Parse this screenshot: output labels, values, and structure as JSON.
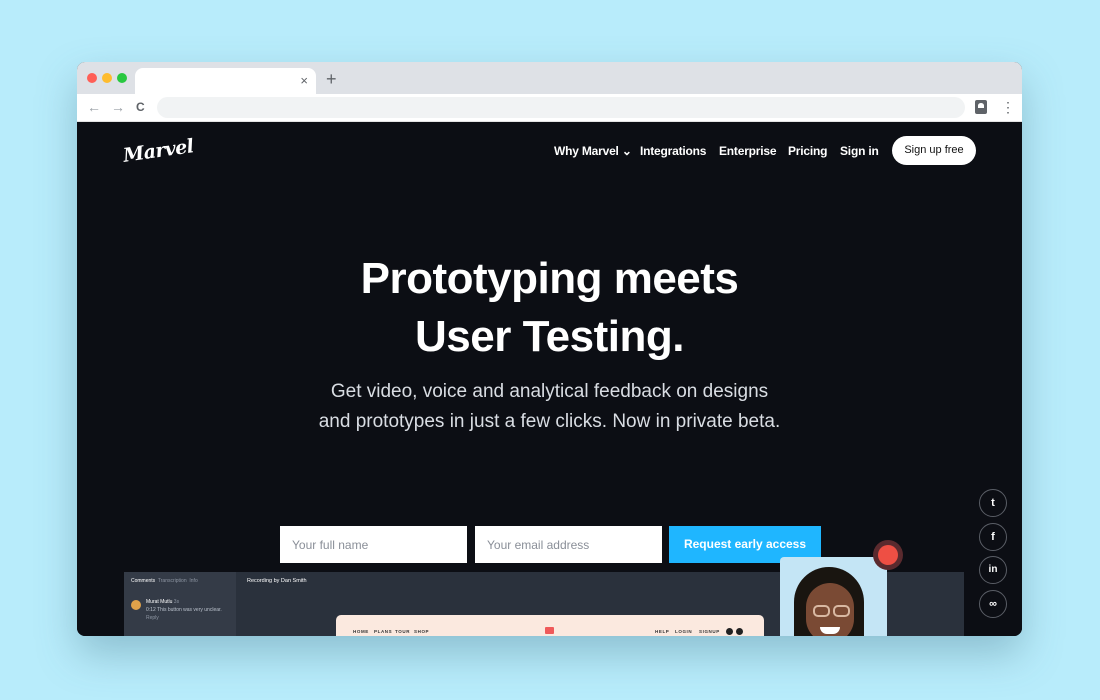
{
  "browser": {
    "tab_close": "×",
    "new_tab": "+",
    "back": "←",
    "forward": "→",
    "reload": "C",
    "menu": "⋮",
    "traffic_lights": [
      "#ff5f57",
      "#febc2e",
      "#28c840"
    ]
  },
  "site": {
    "logo": "Marvel",
    "nav": {
      "why_marvel": "Why Marvel",
      "why_marvel_chevron": "⌄",
      "integrations": "Integrations",
      "enterprise": "Enterprise",
      "pricing": "Pricing",
      "sign_in": "Sign in",
      "sign_up": "Sign up free"
    },
    "hero": {
      "headline_line1": "Prototyping meets",
      "headline_line2": "User Testing.",
      "sub_line1": "Get video, voice and analytical feedback on designs",
      "sub_line2": "and prototypes in just a few clicks. Now in private beta."
    },
    "form": {
      "name_placeholder": "Your full name",
      "email_placeholder": "Your email address",
      "cta": "Request early access"
    },
    "social": {
      "twitter": "t",
      "facebook": "f",
      "linkedin": "in",
      "link": "∞"
    },
    "colors": {
      "background": "#0c0e14",
      "accent": "#1fb6ff",
      "record": "#ee4f44"
    }
  },
  "preview": {
    "tabs": [
      "Comments",
      "Transcription",
      "Info"
    ],
    "comment_author": "Murat Mutlu",
    "comment_time": "3s",
    "comment_text": "0:12 This button was very unclear.",
    "comment_reply": "Reply",
    "recording_title": "Recording by Dan Smith",
    "inner_nav_left": [
      "HOME",
      "PLANS",
      "TOUR",
      "SHOP"
    ],
    "inner_nav_right": [
      "HELP",
      "LOGIN",
      "SIGNUP"
    ]
  }
}
